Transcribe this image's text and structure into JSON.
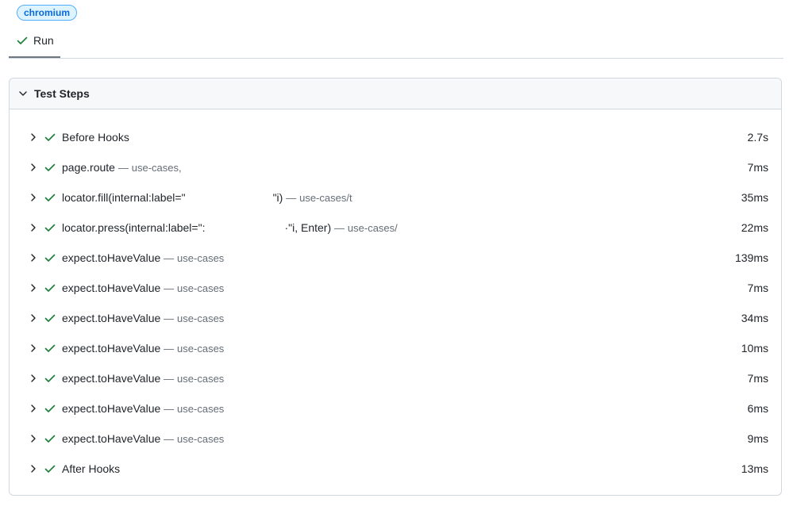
{
  "project_badge": "chromium",
  "tab": {
    "label": "Run",
    "icon": "check-icon"
  },
  "panel": {
    "title": "Test Steps",
    "icon": "chevron-down-icon"
  },
  "colors": {
    "success": "#1a7f37",
    "badge_bg": "#ddf4ff",
    "badge_text": "#0969da",
    "border": "#d0d7de",
    "muted": "#656d76"
  },
  "steps": [
    {
      "title": "Before Hooks",
      "location": "",
      "duration": "2.7s"
    },
    {
      "title": "page.route",
      "location": "use-cases,",
      "duration": "7ms"
    },
    {
      "title": "locator.fill(internal:label=\"",
      "title_tail": "\"i)",
      "location": "use-cases/t",
      "duration": "35ms"
    },
    {
      "title": "locator.press(internal:label=\":",
      "title_tail": "·\"i, Enter)",
      "location": "use-cases/",
      "duration": "22ms"
    },
    {
      "title": "expect.toHaveValue",
      "location": "use-cases",
      "duration": "139ms"
    },
    {
      "title": "expect.toHaveValue",
      "location": "use-cases",
      "duration": "7ms"
    },
    {
      "title": "expect.toHaveValue",
      "location": "use-cases",
      "duration": "34ms"
    },
    {
      "title": "expect.toHaveValue",
      "location": "use-cases",
      "duration": "10ms"
    },
    {
      "title": "expect.toHaveValue",
      "location": "use-cases",
      "duration": "7ms"
    },
    {
      "title": "expect.toHaveValue",
      "location": "use-cases",
      "duration": "6ms"
    },
    {
      "title": "expect.toHaveValue",
      "location": "use-cases",
      "duration": "9ms"
    },
    {
      "title": "After Hooks",
      "location": "",
      "duration": "13ms"
    }
  ],
  "separator": "—"
}
